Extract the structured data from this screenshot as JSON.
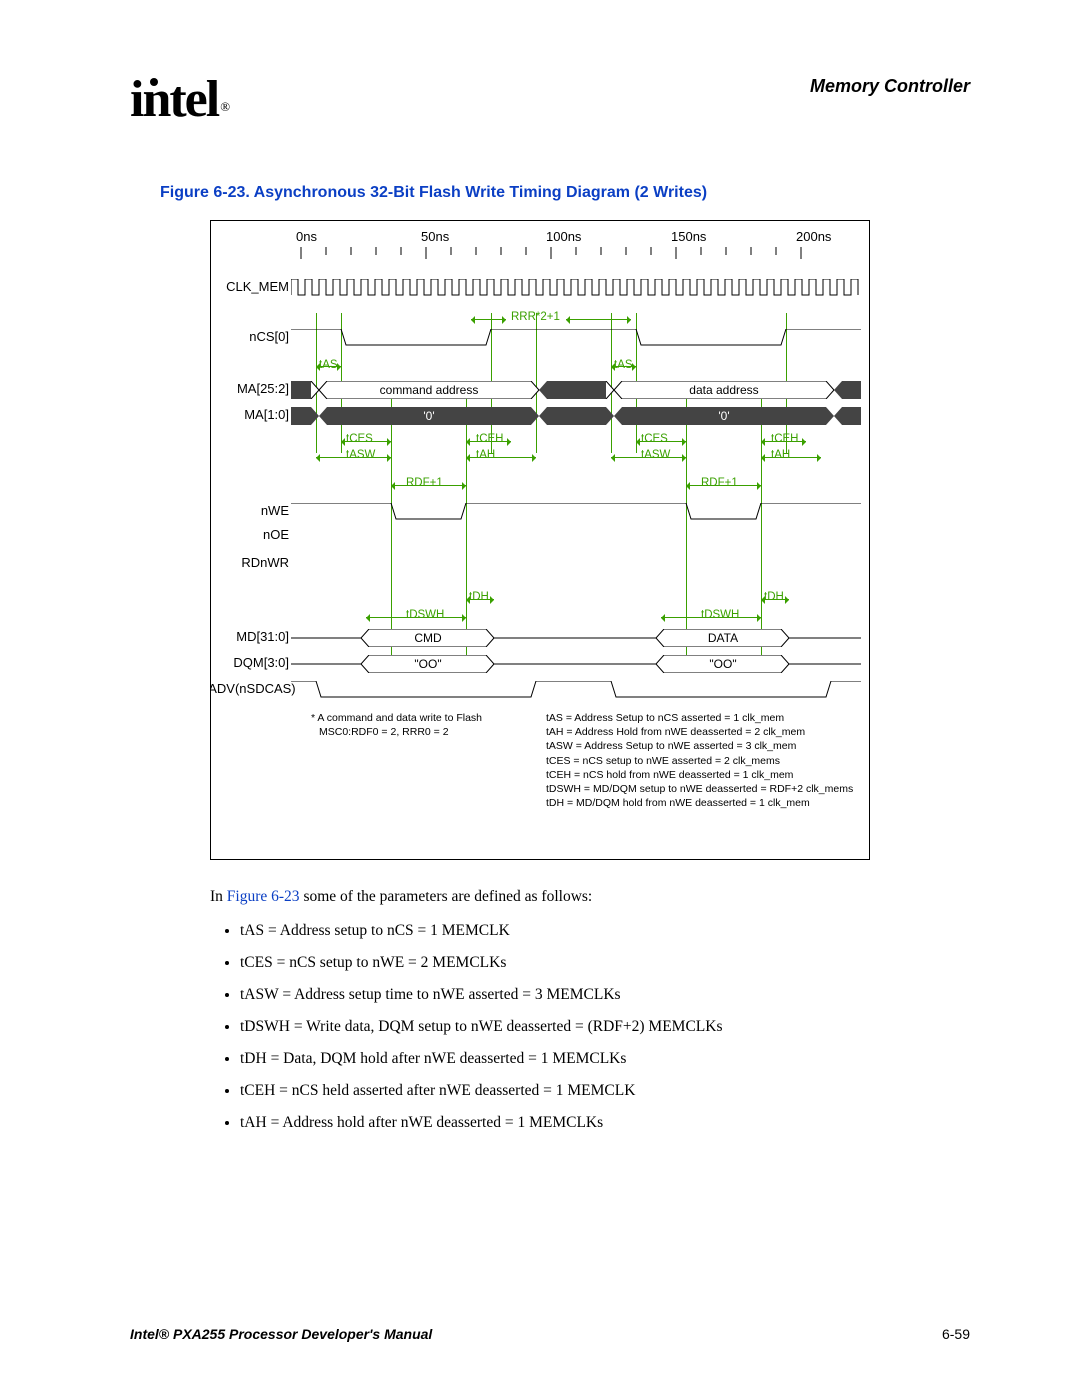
{
  "header": {
    "logo_text": "intel",
    "reg": "®",
    "title": "Memory Controller"
  },
  "figure": {
    "caption": "Figure 6-23. Asynchronous 32-Bit Flash Write Timing Diagram (2 Writes)"
  },
  "diagram": {
    "time_labels": [
      "0ns",
      "50ns",
      "100ns",
      "150ns",
      "200ns"
    ],
    "signals": {
      "clk": "CLK_MEM",
      "ncs": "nCS[0]",
      "ma25": "MA[25:2]",
      "ma10": "MA[1:0]",
      "nwe": "nWE",
      "noe": "nOE",
      "rdnwr": "RDnWR",
      "md31": "MD[31:0]",
      "dqm": "DQM[3:0]",
      "nadv": "nADV(nSDCAS)"
    },
    "annotations": {
      "rrr": "RRR*2+1",
      "tas": "tAS",
      "cmd_addr": "command address",
      "data_addr": "data address",
      "zero": "'0'",
      "tces": "tCES",
      "tasw": "tASW",
      "tceh": "tCEH",
      "tah": "tAH",
      "rdf": "RDF+1",
      "tdh": "tDH",
      "tdswh": "tDSWH",
      "cmd": "CMD",
      "data": "DATA",
      "oo": "\"OO\""
    },
    "footnote_left": {
      "l1": "* A command and data write to Flash",
      "l2": "MSC0:RDF0 = 2, RRR0 = 2"
    },
    "footnote_right": {
      "l1": "tAS = Address Setup to nCS asserted = 1 clk_mem",
      "l2": "tAH = Address Hold from nWE deasserted = 2 clk_mem",
      "l3": "tASW = Address Setup to nWE asserted = 3 clk_mem",
      "l4": "tCES = nCS setup to nWE asserted = 2 clk_mems",
      "l5": "tCEH = nCS hold from nWE deasserted = 1 clk_mem",
      "l6": "tDSWH = MD/DQM setup to nWE deasserted = RDF+2 clk_mems",
      "l7": "tDH = MD/DQM hold from nWE deasserted = 1 clk_mem"
    },
    "chart_data": {
      "type": "timing-diagram",
      "time_ns": {
        "start": 0,
        "end": 200,
        "ticks_ns": 50,
        "minor_ticks_per": 4
      },
      "clock_period_ns": 5,
      "signals": [
        {
          "name": "CLK_MEM",
          "kind": "clock"
        },
        {
          "name": "nCS[0]",
          "kind": "digital",
          "phases": [
            "high",
            "low",
            "high",
            "low",
            "high"
          ]
        },
        {
          "name": "MA[25:2]",
          "kind": "bus",
          "phases": [
            "x",
            "command address",
            "x",
            "data address",
            "x"
          ]
        },
        {
          "name": "MA[1:0]",
          "kind": "bus",
          "phases": [
            "x",
            "'0'",
            "x",
            "'0'",
            "x"
          ]
        },
        {
          "name": "nWE",
          "kind": "digital",
          "phases": [
            "high",
            "low",
            "high",
            "low",
            "high"
          ]
        },
        {
          "name": "nOE",
          "kind": "digital",
          "constant": "high"
        },
        {
          "name": "RDnWR",
          "kind": "digital",
          "constant": "low"
        },
        {
          "name": "MD[31:0]",
          "kind": "bus",
          "phases": [
            "z",
            "CMD",
            "z",
            "DATA",
            "z"
          ]
        },
        {
          "name": "DQM[3:0]",
          "kind": "bus",
          "phases": [
            "z",
            "\"OO\"",
            "z",
            "\"OO\"",
            "z"
          ]
        },
        {
          "name": "nADV(nSDCAS)",
          "kind": "digital",
          "phases": [
            "high",
            "low",
            "high",
            "low",
            "high"
          ]
        }
      ],
      "parameters_memclks": {
        "tAS": 1,
        "tCES": 2,
        "tASW": 3,
        "RDF": 2,
        "tDSWH": "RDF+2",
        "tDH": 1,
        "tCEH": 1,
        "tAH": 1,
        "RRR_gap": "RRR*2+1",
        "RRR0": 2,
        "RDF0": 2
      }
    }
  },
  "body": {
    "intro_pre": "In ",
    "figref": "Figure 6-23",
    "intro_post": " some of the parameters are defined as follows:",
    "bullets": [
      "tAS = Address setup to nCS = 1 MEMCLK",
      "tCES = nCS setup to nWE = 2 MEMCLKs",
      "tASW = Address setup time to nWE asserted = 3 MEMCLKs",
      "tDSWH = Write data, DQM setup to nWE deasserted = (RDF+2) MEMCLKs",
      "tDH = Data, DQM hold after nWE deasserted = 1 MEMCLKs",
      "tCEH = nCS held asserted after nWE deasserted = 1 MEMCLK",
      "tAH = Address hold after nWE deasserted = 1 MEMCLKs"
    ]
  },
  "footer": {
    "left": "Intel® PXA255 Processor Developer's Manual",
    "right": "6-59"
  }
}
